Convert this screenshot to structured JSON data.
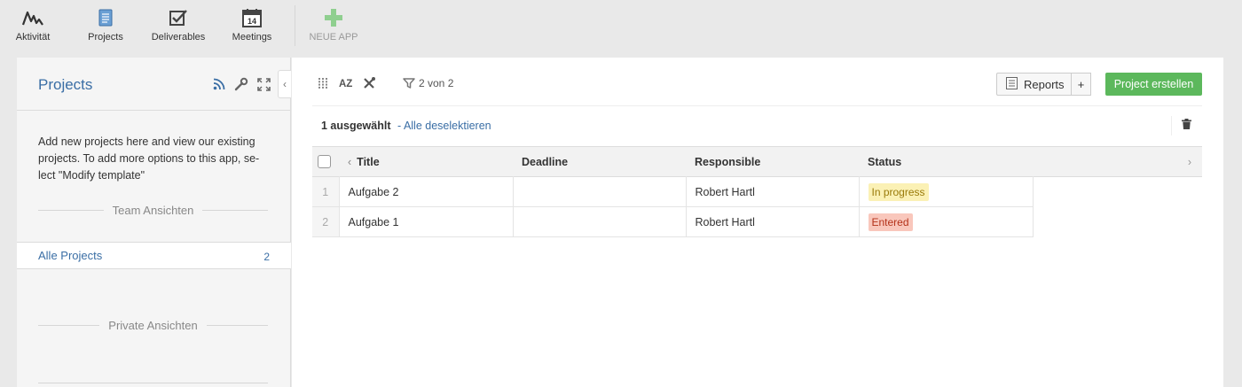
{
  "appbar": {
    "apps": [
      {
        "label": "Aktivität",
        "icon": "activity-icon"
      },
      {
        "label": "Projects",
        "icon": "document-icon"
      },
      {
        "label": "Deliverables",
        "icon": "checkbox-icon"
      },
      {
        "label": "Meetings",
        "icon": "calendar-icon",
        "calendar_day": "14"
      },
      {
        "label": "NEUE APP",
        "icon": "plus-icon"
      }
    ]
  },
  "sidebar": {
    "title": "Projects",
    "description": "Add new projects here and view our existing projects. To add more options to this app, se-lect \"Modify template\"",
    "team_section": "Team Ansichten",
    "views": [
      {
        "label": "Alle Projects",
        "count": "2"
      }
    ],
    "private_section": "Private Ansichten"
  },
  "toolbar": {
    "sort_label": "AZ",
    "filter_count": "2 von 2",
    "reports_label": "Reports",
    "plus_label": "+",
    "create_label": "Project erstellen"
  },
  "selection": {
    "count_label": "1 ausgewählt",
    "deselect_label": "- Alle deselektieren"
  },
  "table": {
    "columns": [
      "Title",
      "Deadline",
      "Responsible",
      "Status"
    ],
    "rows": [
      {
        "num": "1",
        "title": "Aufgabe 2",
        "deadline": "",
        "responsible": "Robert Hartl",
        "status": "In progress"
      },
      {
        "num": "2",
        "title": "Aufgabe 1",
        "deadline": "",
        "responsible": "Robert Hartl",
        "status": "Entered"
      }
    ]
  },
  "colors": {
    "accent": "#3a6ea5",
    "create_button": "#5cb85c",
    "status_in_progress": "#fbf1b5",
    "status_entered": "#f9c7bc"
  }
}
